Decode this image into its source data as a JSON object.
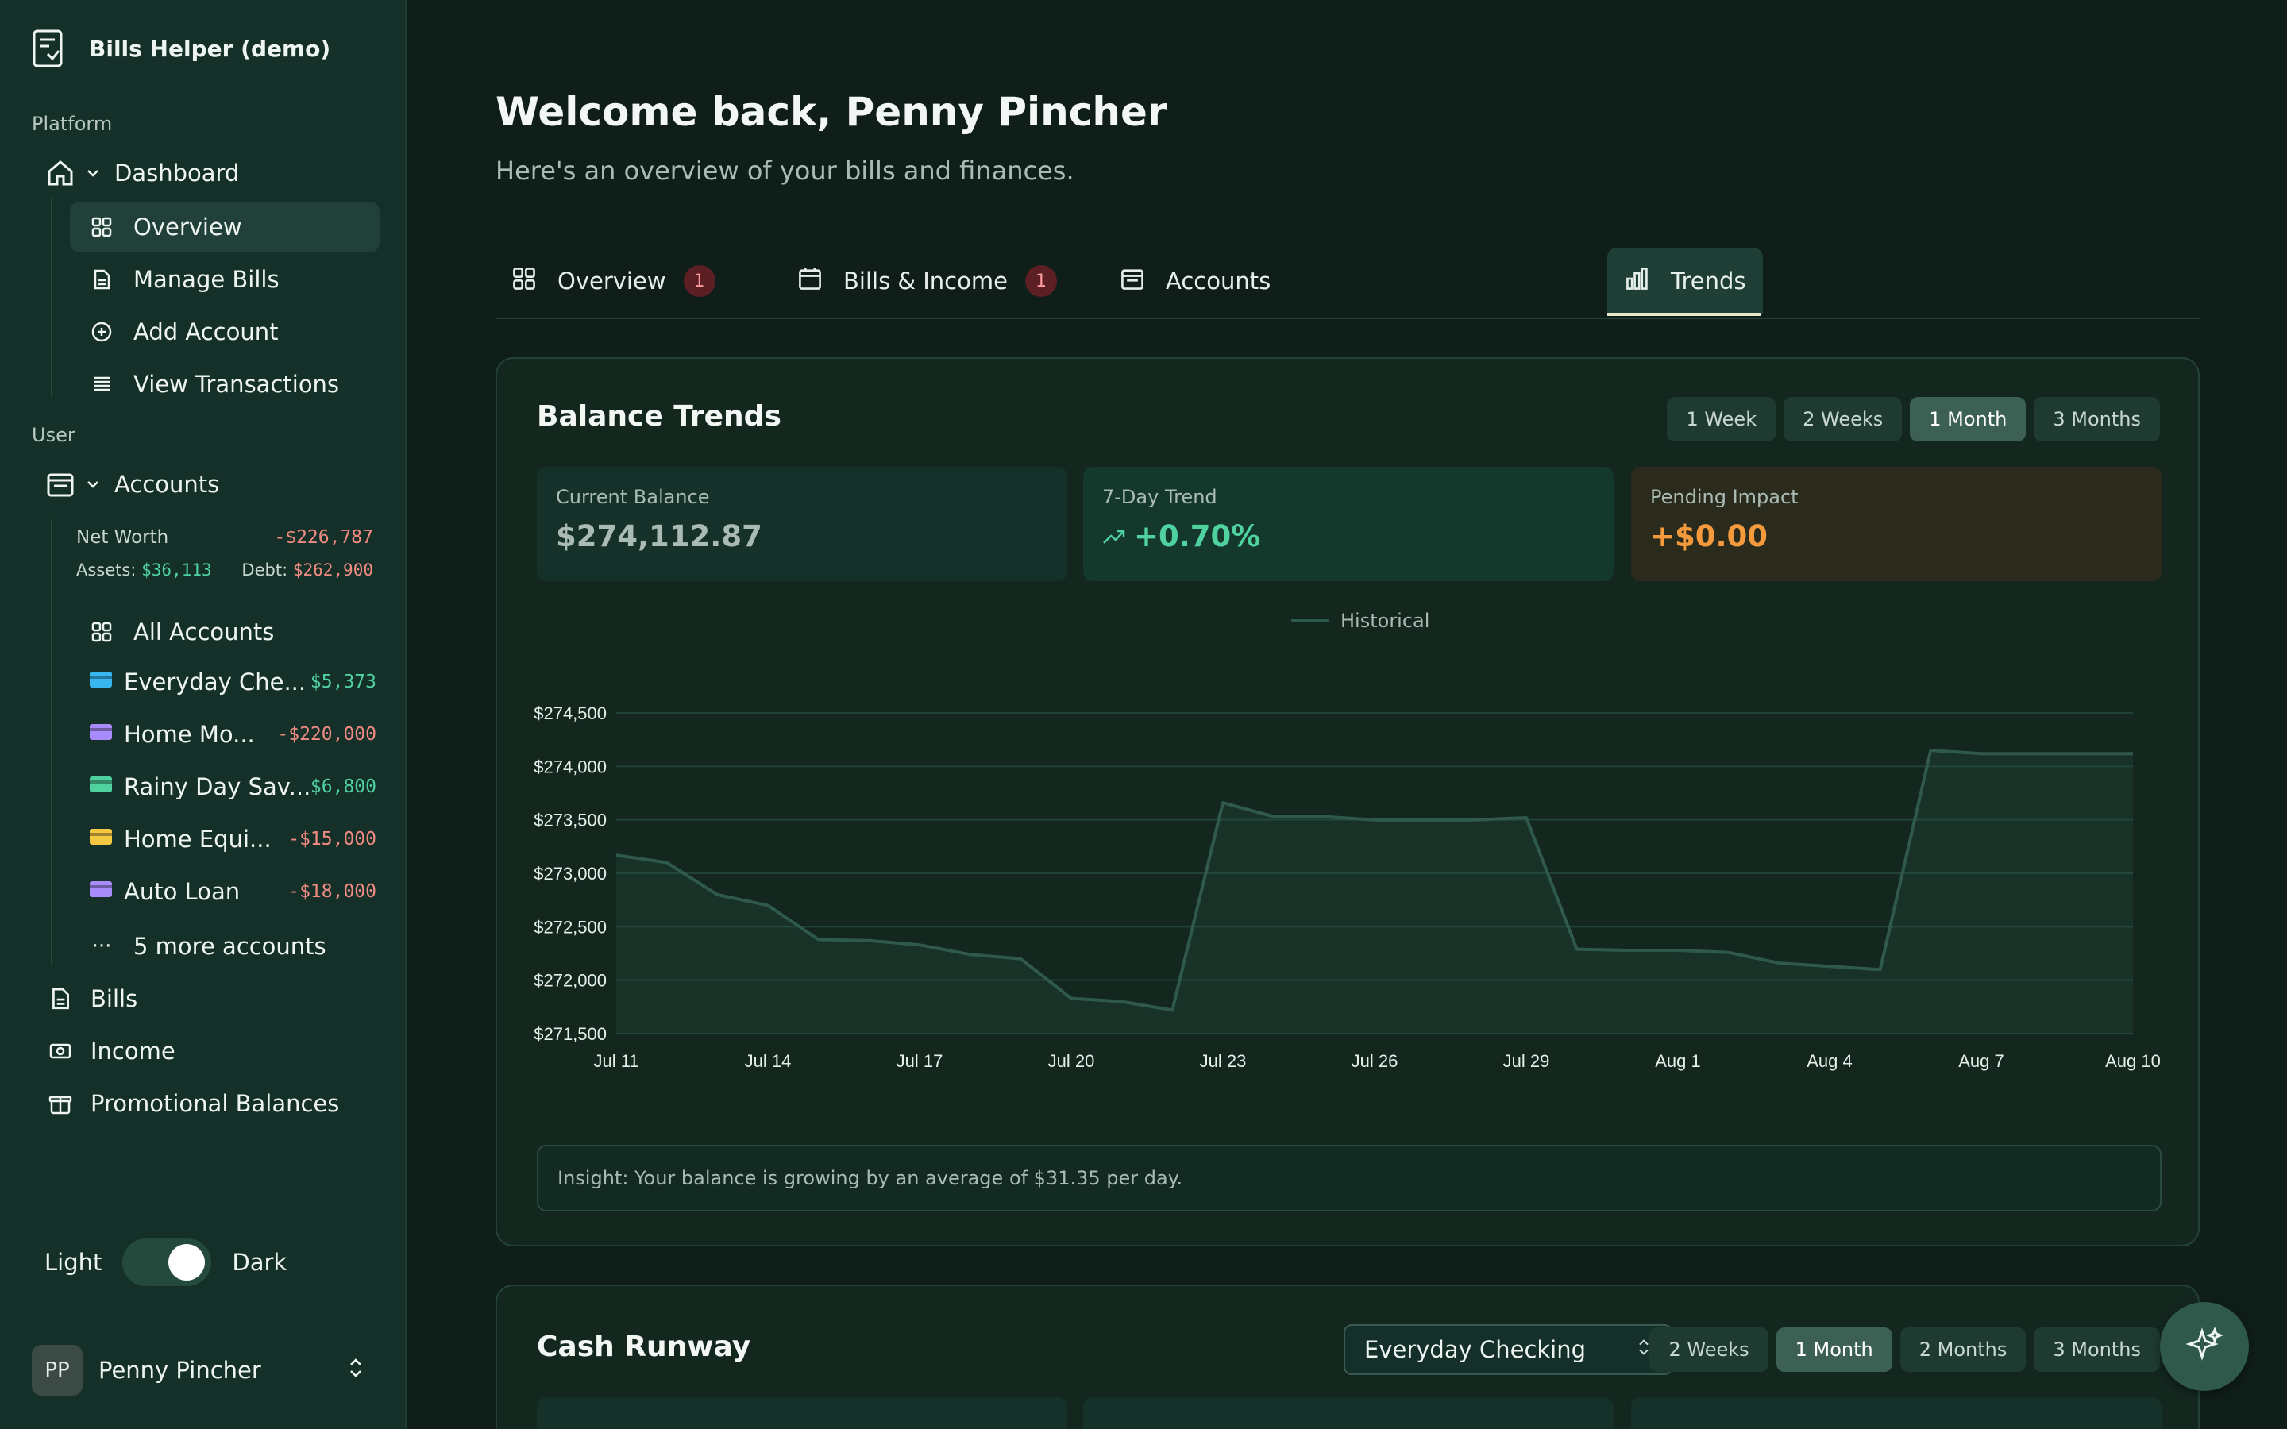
{
  "app": {
    "title": "Bills Helper (demo)"
  },
  "sidebar": {
    "platform_label": "Platform",
    "dashboard_label": "Dashboard",
    "dashboard_items": [
      {
        "label": "Overview",
        "icon": "grid-icon"
      },
      {
        "label": "Manage Bills",
        "icon": "document-icon"
      },
      {
        "label": "Add Account",
        "icon": "plus-circle-icon"
      },
      {
        "label": "View Transactions",
        "icon": "list-icon"
      }
    ],
    "user_label": "User",
    "accounts_label": "Accounts",
    "net_worth_label": "Net Worth",
    "net_worth_value": "-$226,787",
    "assets_label": "Assets:",
    "assets_value": "$36,113",
    "debt_label": "Debt:",
    "debt_value": "$262,900",
    "all_accounts_label": "All Accounts",
    "accounts": [
      {
        "name": "Everyday Che...",
        "amount": "$5,373",
        "sign": "pos",
        "icon": "card-icon",
        "color": "#38b6f0"
      },
      {
        "name": "Home Mo...",
        "amount": "-$220,000",
        "sign": "neg",
        "icon": "bank-icon",
        "color": "#a78bfa"
      },
      {
        "name": "Rainy Day Sav...",
        "amount": "$6,800",
        "sign": "pos",
        "icon": "cash-icon",
        "color": "#4fd1a0"
      },
      {
        "name": "Home Equi...",
        "amount": "-$15,000",
        "sign": "neg",
        "icon": "credit-card-icon",
        "color": "#f5c842"
      },
      {
        "name": "Auto Loan",
        "amount": "-$18,000",
        "sign": "neg",
        "icon": "bank-icon",
        "color": "#a78bfa"
      }
    ],
    "more_accounts_label": "5 more accounts",
    "bills_label": "Bills",
    "income_label": "Income",
    "promo_label": "Promotional Balances",
    "theme_light": "Light",
    "theme_dark": "Dark",
    "user_initials": "PP",
    "user_name": "Penny Pincher"
  },
  "main": {
    "title": "Welcome back, Penny Pincher",
    "subtitle": "Here's an overview of your bills and finances.",
    "tabs": [
      {
        "label": "Overview",
        "badge": "1"
      },
      {
        "label": "Bills & Income",
        "badge": "1"
      },
      {
        "label": "Accounts",
        "badge": ""
      },
      {
        "label": "Trends",
        "badge": ""
      }
    ]
  },
  "balance_trends": {
    "title": "Balance Trends",
    "ranges": [
      "1 Week",
      "2 Weeks",
      "1 Month",
      "3 Months"
    ],
    "selected_range": "1 Month",
    "current_balance_label": "Current Balance",
    "current_balance_value": "$274,112.87",
    "trend_label": "7-Day Trend",
    "trend_value": "+0.70%",
    "pending_label": "Pending Impact",
    "pending_value": "+$0.00",
    "legend_label": "Historical",
    "insight_prefix": "Insight:",
    "insight_text": " Your balance is growing by an average of $31.35 per day."
  },
  "chart_data": {
    "type": "line",
    "title": "",
    "xlabel": "",
    "ylabel": "",
    "ylim": [
      271500,
      274500
    ],
    "yticks": [
      274500,
      274000,
      273500,
      273000,
      272500,
      272000,
      271500
    ],
    "ytick_labels": [
      "$274,500",
      "$274,000",
      "$273,500",
      "$273,000",
      "$272,500",
      "$272,000",
      "$271,500"
    ],
    "xtick_labels": [
      "Jul 11",
      "Jul 14",
      "Jul 17",
      "Jul 20",
      "Jul 23",
      "Jul 26",
      "Jul 29",
      "Aug 1",
      "Aug 4",
      "Aug 7",
      "Aug 10"
    ],
    "grid": true,
    "legend": "top-center",
    "series": [
      {
        "name": "Historical",
        "x": [
          "Jul 11",
          "Jul 12",
          "Jul 13",
          "Jul 14",
          "Jul 15",
          "Jul 16",
          "Jul 17",
          "Jul 18",
          "Jul 19",
          "Jul 20",
          "Jul 21",
          "Jul 22",
          "Jul 23",
          "Jul 24",
          "Jul 25",
          "Jul 26",
          "Jul 27",
          "Jul 28",
          "Jul 29",
          "Jul 30",
          "Jul 31",
          "Aug 1",
          "Aug 2",
          "Aug 3",
          "Aug 4",
          "Aug 5",
          "Aug 6",
          "Aug 7",
          "Aug 8",
          "Aug 9",
          "Aug 10"
        ],
        "values": [
          273170,
          273100,
          272800,
          272700,
          272380,
          272370,
          272330,
          272240,
          272200,
          271830,
          271800,
          271720,
          273660,
          273530,
          273530,
          273500,
          273500,
          273500,
          273520,
          272290,
          272280,
          272280,
          272260,
          272160,
          272130,
          272100,
          274150,
          274120,
          274120,
          274120,
          274120
        ]
      }
    ]
  },
  "cash_runway": {
    "title": "Cash Runway",
    "account_select": "Everyday Checking",
    "ranges": [
      "2 Weeks",
      "1 Month",
      "2 Months",
      "3 Months"
    ],
    "selected_range": "1 Month"
  },
  "colors": {
    "accent": "#4fd1a0",
    "negative": "#f28b82",
    "pending": "#f59a3c",
    "line": "#2f5a4b"
  }
}
